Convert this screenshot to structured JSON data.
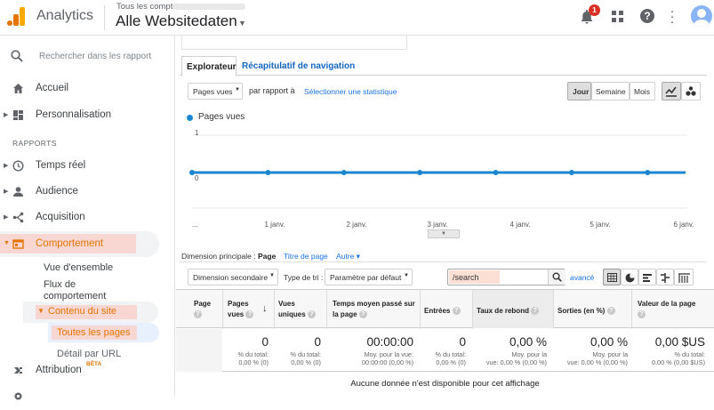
{
  "header": {
    "app_name": "Analytics",
    "breadcrumb": "Tous les comptes >",
    "account_name": "Alle Websitedaten",
    "notification_count": "1"
  },
  "sidebar": {
    "search_placeholder": "Rechercher dans les rapport",
    "items": [
      {
        "label": "Accueil"
      },
      {
        "label": "Personnalisation"
      }
    ],
    "section_label": "RAPPORTS",
    "reports": [
      {
        "label": "Temps réel"
      },
      {
        "label": "Audience"
      },
      {
        "label": "Acquisition"
      },
      {
        "label": "Comportement"
      }
    ],
    "behavior_sub": [
      {
        "label": "Vue d'ensemble"
      },
      {
        "label": "Flux de"
      },
      {
        "label": "comportement"
      }
    ],
    "content_label": "Contenu du site",
    "content_sub": [
      {
        "label": "Toutes les pages"
      },
      {
        "label": "Détail par URL"
      }
    ],
    "attribution_label": "Attribution",
    "attribution_badge": "BÊTA"
  },
  "main": {
    "tabs": [
      {
        "label": "Explorateur"
      },
      {
        "label": "Récapitulatif de navigation"
      }
    ],
    "metric_select": "Pages vues",
    "compare_label": "par rapport à",
    "select_stat_link": "Sélectionner une statistique",
    "period_buttons": [
      {
        "label": "Jour"
      },
      {
        "label": "Semaine"
      },
      {
        "label": "Mois"
      }
    ],
    "dimension_label": "Dimension principale :",
    "dimension_active": "Page",
    "dimension_links": [
      {
        "label": "Titre de page"
      },
      {
        "label": "Autre ▾"
      }
    ],
    "secondary_dim": "Dimension secondaire",
    "sort_label": "Type de tri :",
    "sort_select": "Paramètre par défaut",
    "search_value": "/search",
    "advanced_link": "avancé",
    "table_headers": [
      "Page",
      "Pages vues",
      "Vues uniques",
      "Temps moyen passé sur la page",
      "Entrées",
      "Taux de rebond",
      "Sorties (en %)",
      "Valeur de la page"
    ],
    "totals": [
      {
        "value": "0",
        "sub1": "% du total:",
        "sub2": "0,00 % (0)"
      },
      {
        "value": "0",
        "sub1": "% du total:",
        "sub2": "0,00 % (0)"
      },
      {
        "value": "00:00:00",
        "sub1": "Moy. pour la vue:",
        "sub2": "00:00:00 (0,00 %)"
      },
      {
        "value": "0",
        "sub1": "% du total:",
        "sub2": "0,00 % (0)"
      },
      {
        "value": "0,00 %",
        "sub1": "Moy. pour la",
        "sub2": "vue: 0,00 % (0,00 %)"
      },
      {
        "value": "0,00 %",
        "sub1": "Moy. pour la",
        "sub2": "vue: 0,00 % (0,00 %)"
      },
      {
        "value": "0,00 $US",
        "sub1": "% du total:",
        "sub2": "0,00 % (0,00 $US)"
      }
    ],
    "no_data": "Aucune donnée n'est disponible pour cet affichage"
  },
  "chart_data": {
    "type": "line",
    "series": [
      {
        "name": "Pages vues",
        "values": [
          0,
          0,
          0,
          0,
          0,
          0,
          0,
          0,
          0,
          0,
          0,
          0,
          0,
          0
        ]
      }
    ],
    "x_ticks": [
      "...",
      "1 janv.",
      "2 janv.",
      "3 janv.",
      "4 janv.",
      "5 janv.",
      "6 janv."
    ],
    "y_ticks": [
      "1",
      "0"
    ],
    "ylim": [
      0,
      1
    ],
    "color": "#1a86d0"
  },
  "colors": {
    "accent": "#1a73e8",
    "active_nav": "#fce8e6",
    "active_text": "#e37400",
    "chart_line": "#1a86d0"
  }
}
